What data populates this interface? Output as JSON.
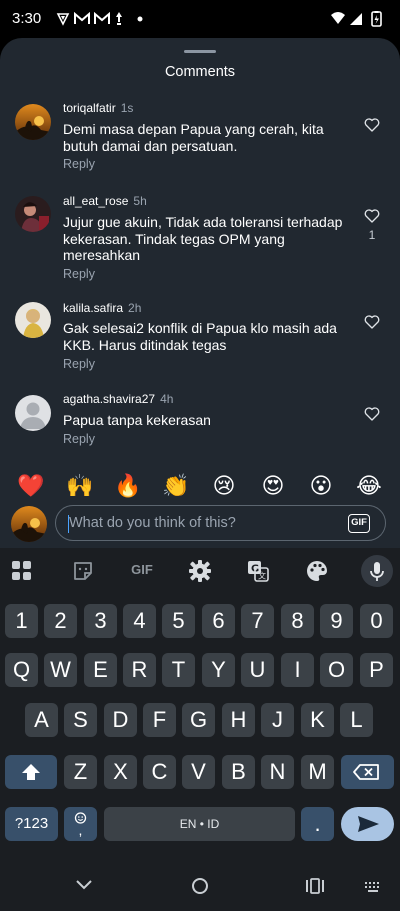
{
  "status_bar": {
    "time": "3:30",
    "icons": [
      "protonvpn-icon",
      "gmail-icon",
      "gmail-icon",
      "lamp-icon",
      "dot-icon",
      "wifi-icon",
      "signal-icon",
      "battery-icon"
    ]
  },
  "sheet": {
    "title": "Comments"
  },
  "comments": [
    {
      "username": "toriqalfatir",
      "time_ago": "1s",
      "text": "Demi masa depan Papua yang cerah, kita butuh damai dan persatuan.",
      "reply_label": "Reply",
      "likes": ""
    },
    {
      "username": "all_eat_rose",
      "time_ago": "5h",
      "text": "Jujur gue akuin, Tidak ada toleransi terhadap kekerasan. Tindak tegas OPM yang meresahkan",
      "reply_label": "Reply",
      "likes": "1"
    },
    {
      "username": "kalila.safira",
      "time_ago": "2h",
      "text": "Gak selesai2 konflik di Papua klo masih ada KKB. Harus ditindak tegas",
      "reply_label": "Reply",
      "likes": ""
    },
    {
      "username": "agatha.shavira27",
      "time_ago": "4h",
      "text": "Papua tanpa kekerasan",
      "reply_label": "Reply",
      "likes": ""
    }
  ],
  "emoji_reactions": [
    "❤️",
    "🙌",
    "🔥",
    "👏",
    "😢",
    "😍",
    "😮",
    "😂"
  ],
  "composer": {
    "placeholder": "What do you think of this?",
    "value": "",
    "gif_label": "GIF"
  },
  "keyboard": {
    "toolbar": [
      "apps-grid-icon",
      "sticker-icon",
      "gif-icon",
      "settings-gear-icon",
      "translate-icon",
      "palette-icon",
      "microphone-icon"
    ],
    "toolbar_gif_label": "GIF",
    "row_numbers": [
      "1",
      "2",
      "3",
      "4",
      "5",
      "6",
      "7",
      "8",
      "9",
      "0"
    ],
    "row1": [
      "Q",
      "W",
      "E",
      "R",
      "T",
      "Y",
      "U",
      "I",
      "O",
      "P"
    ],
    "row2": [
      "A",
      "S",
      "D",
      "F",
      "G",
      "H",
      "J",
      "K",
      "L"
    ],
    "row3": [
      "Z",
      "X",
      "C",
      "V",
      "B",
      "N",
      "M"
    ],
    "symbols_label": "?123",
    "emoji_comma_label": "☺\n,",
    "space_label": "EN • ID",
    "period_label": "."
  },
  "nav_bar": {
    "buttons": [
      "back-chevron-icon",
      "home-circle-icon",
      "recents-icon",
      "keyboard-switch-icon"
    ]
  },
  "colors": {
    "sheet_bg": "#212830",
    "keyboard_bg": "#1b1e22",
    "key_bg": "#3b4147",
    "accent_key": "#38506a",
    "muted_text": "#9aa4b0"
  }
}
